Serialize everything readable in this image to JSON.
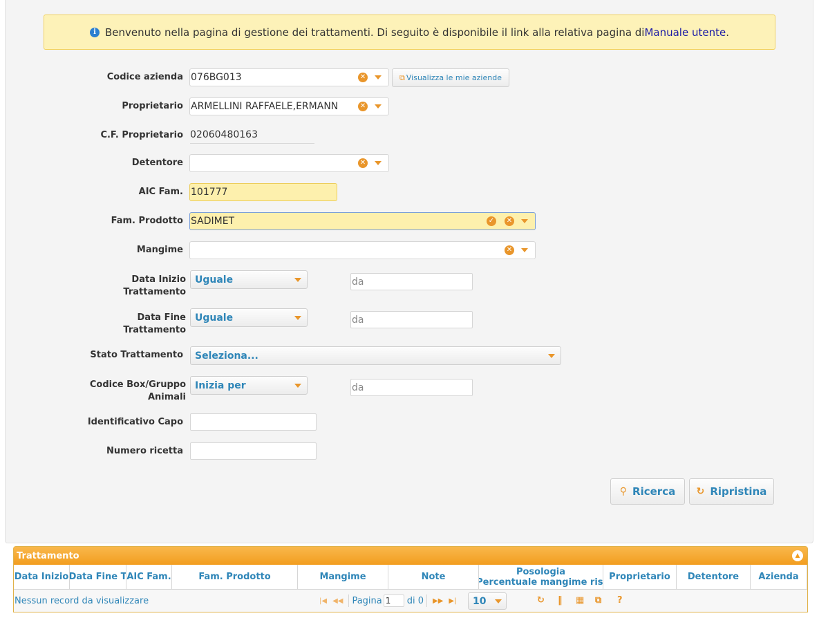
{
  "info": {
    "text": "Benvenuto nella pagina di gestione dei trattamenti. Di seguito è disponibile il link alla relativa pagina di ",
    "link": "Manuale utente",
    "end": "."
  },
  "form": {
    "codice_azienda": {
      "label": "Codice azienda",
      "value": "076BG013"
    },
    "visualizza_button": "Visualizza le mie aziende",
    "proprietario": {
      "label": "Proprietario",
      "value": "ARMELLINI RAFFAELE,ERMANN"
    },
    "cf_proprietario": {
      "label": "C.F. Proprietario",
      "value": "02060480163"
    },
    "detentore": {
      "label": "Detentore",
      "value": ""
    },
    "aic_fam": {
      "label": "AIC Fam.",
      "value": "101777"
    },
    "fam_prodotto": {
      "label": "Fam. Prodotto",
      "value": "SADIMET"
    },
    "mangime": {
      "label": "Mangime",
      "value": ""
    },
    "data_inizio": {
      "label_line1": "Data Inizio",
      "label_line2": "Trattamento",
      "operator": "Uguale",
      "placeholder": "da"
    },
    "data_fine": {
      "label_line1": "Data Fine",
      "label_line2": "Trattamento",
      "operator": "Uguale",
      "placeholder": "da"
    },
    "stato_trattamento": {
      "label": "Stato Trattamento",
      "value": "Seleziona..."
    },
    "codice_box": {
      "label_line1": "Codice Box/Gruppo",
      "label_line2": "Animali",
      "operator": "Inizia per",
      "placeholder": "da"
    },
    "identificativo_capo": {
      "label": "Identificativo Capo",
      "value": ""
    },
    "numero_ricetta": {
      "label": "Numero ricetta",
      "value": ""
    }
  },
  "buttons": {
    "ricerca": "Ricerca",
    "ripristina": "Ripristina"
  },
  "grid": {
    "title": "Trattamento",
    "columns": [
      {
        "label": "Data Inizio"
      },
      {
        "label": "Data Fine T"
      },
      {
        "label": "AIC Fam."
      },
      {
        "label": "Fam. Prodotto"
      },
      {
        "label": "Mangime"
      },
      {
        "label": "Note"
      },
      {
        "label": "Posologia",
        "label2": "(Percentuale mangime risp"
      },
      {
        "label": "Proprietario"
      },
      {
        "label": "Detentore"
      },
      {
        "label": "Azienda"
      }
    ],
    "empty_text": "Nessun record da visualizzare",
    "page_label": "Pagina",
    "page_value": "1",
    "page_of": "di 0",
    "rows_per_page": "10"
  }
}
